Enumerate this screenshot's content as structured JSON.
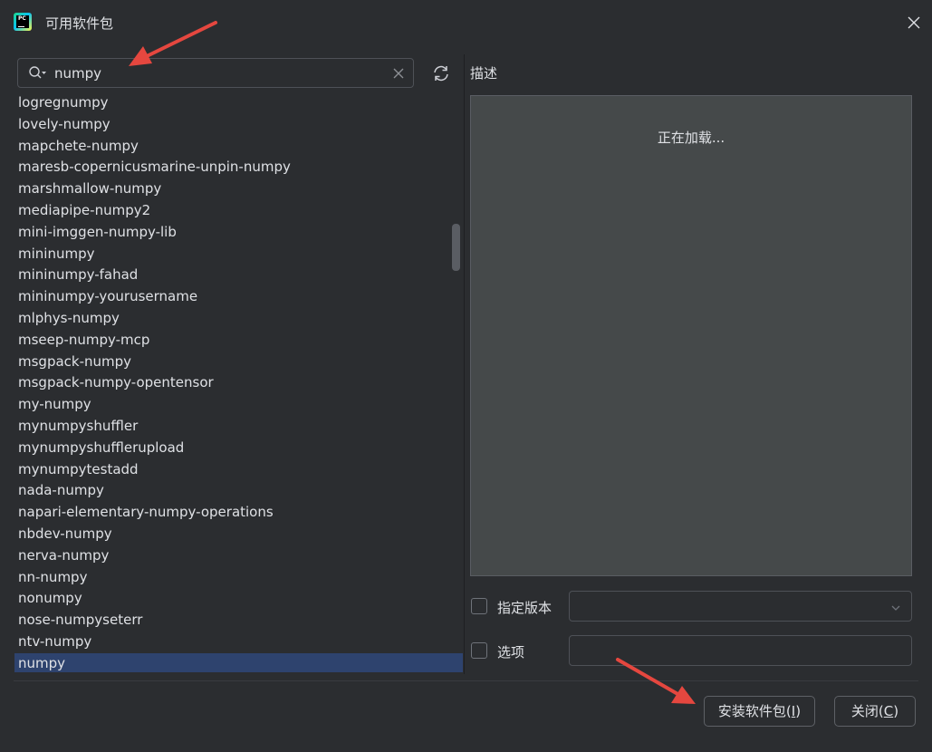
{
  "window": {
    "title": "可用软件包",
    "app_icon": "pycharm-logo-icon",
    "close_icon": "close-icon"
  },
  "search": {
    "value": "numpy",
    "placeholder": ""
  },
  "packages": [
    "logregnumpy",
    "lovely-numpy",
    "mapchete-numpy",
    "maresb-copernicusmarine-unpin-numpy",
    "marshmallow-numpy",
    "mediapipe-numpy2",
    "mini-imggen-numpy-lib",
    "mininumpy",
    "mininumpy-fahad",
    "mininumpy-yourusername",
    "mlphys-numpy",
    "mseep-numpy-mcp",
    "msgpack-numpy",
    "msgpack-numpy-opentensor",
    "my-numpy",
    "mynumpyshuffler",
    "mynumpyshufflerupload",
    "mynumpytestadd",
    "nada-numpy",
    "napari-elementary-numpy-operations",
    "nbdev-numpy",
    "nerva-numpy",
    "nn-numpy",
    "nonumpy",
    "nose-numpyseterr",
    "ntv-numpy",
    "numpy"
  ],
  "selected_package": "numpy",
  "description": {
    "label": "描述",
    "loading_text": "正在加载..."
  },
  "options": {
    "version_label": "指定版本",
    "version_checked": false,
    "version_value": "",
    "options_label": "选项",
    "options_checked": false,
    "options_value": ""
  },
  "buttons": {
    "install_text": "安装软件包(",
    "install_mnemonic": "I",
    "install_close": ")",
    "close_text": "关闭(",
    "close_mnemonic": "C",
    "close_close": ")"
  },
  "colors": {
    "background": "#2b2d30",
    "selected": "#2e436e",
    "panel": "#45494a",
    "annotation_arrow": "#e5473f"
  }
}
